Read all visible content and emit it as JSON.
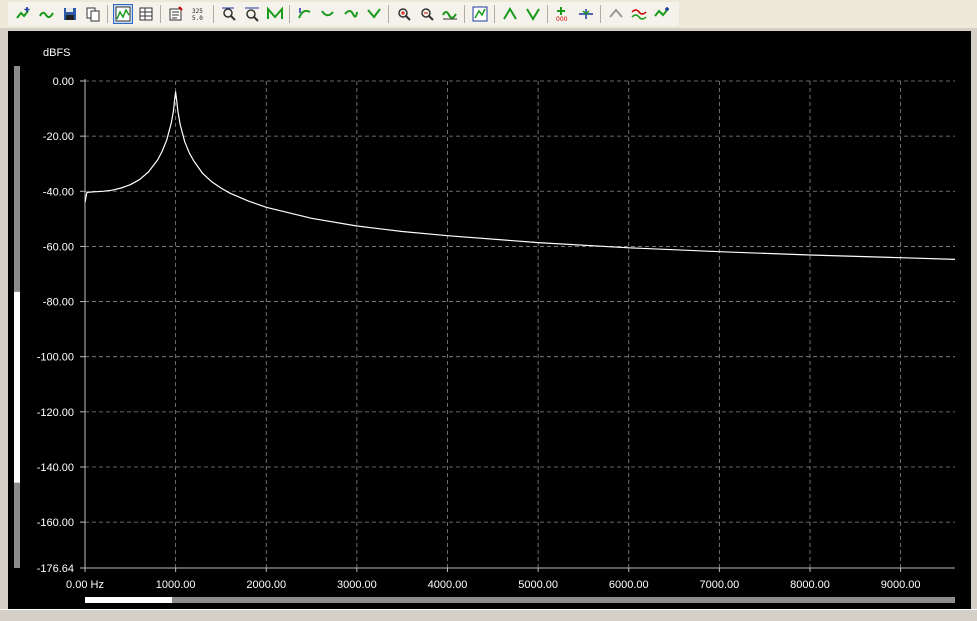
{
  "toolbar": {
    "groups": [
      [
        "add-trace-icon",
        "wave-icon",
        "save-icon",
        "copy-icon"
      ],
      [
        "spectrum-view-icon",
        "data-table-icon"
      ],
      [
        "properties-icon",
        "numeric-grid-icon"
      ],
      [
        "zoom-x-icon",
        "zoom-fit-icon",
        "trace-view-icon"
      ],
      [
        "curve-up-icon",
        "curve-down-icon",
        "curve-right-icon",
        "curve-left-icon"
      ],
      [
        "zoom-in-icon",
        "zoom-out-icon",
        "waveform-icon"
      ],
      [
        "autoscale-icon"
      ],
      [
        "peak-up-icon",
        "peak-down-icon"
      ],
      [
        "marker-icon",
        "cursor-icon"
      ],
      [
        "up-arrow-icon",
        "overlay-icon",
        "settings-icon"
      ]
    ],
    "active": [
      "spectrum-view-icon"
    ]
  },
  "chart_data": {
    "type": "line",
    "title": "",
    "ylabel": "dBFS",
    "xlabel": "",
    "xlim": [
      0,
      9600
    ],
    "ylim": [
      -176.64,
      0
    ],
    "grid": true,
    "y_ticks": [
      0,
      -20,
      -40,
      -60,
      -80,
      -100,
      -120,
      -140,
      -160,
      -176.64
    ],
    "y_tick_labels": [
      "0.00",
      "-20.00",
      "-40.00",
      "-60.00",
      "-80.00",
      "-100.00",
      "-120.00",
      "-140.00",
      "-160.00",
      "-176.64"
    ],
    "x_ticks": [
      0,
      1000,
      2000,
      3000,
      4000,
      5000,
      6000,
      7000,
      8000,
      9000
    ],
    "x_tick_labels": [
      "0.00 Hz",
      "1000.00",
      "2000.00",
      "3000.00",
      "4000.00",
      "5000.00",
      "6000.00",
      "7000.00",
      "8000.00",
      "9000.00"
    ],
    "series": [
      {
        "color": "#ffffff",
        "x": [
          0,
          20,
          50,
          100,
          200,
          300,
          400,
          500,
          600,
          700,
          800,
          850,
          900,
          950,
          975,
          990,
          1000,
          1010,
          1025,
          1050,
          1100,
          1150,
          1200,
          1300,
          1400,
          1500,
          1600,
          1800,
          2000,
          2500,
          3000,
          3500,
          4000,
          5000,
          6000,
          7000,
          8000,
          9000,
          9600
        ],
        "y": [
          -44,
          -40.5,
          -40.3,
          -40.2,
          -40,
          -39.6,
          -38.8,
          -37.6,
          -35.8,
          -33,
          -28.7,
          -25.6,
          -21.5,
          -15.5,
          -11,
          -6.5,
          -4,
          -6.5,
          -11,
          -15.8,
          -22,
          -26,
          -29,
          -33.6,
          -36.6,
          -38.8,
          -40.7,
          -43.5,
          -45.8,
          -49.8,
          -52.6,
          -54.6,
          -56.1,
          -58.6,
          -60.5,
          -61.9,
          -63.1,
          -64.1,
          -64.7
        ]
      }
    ]
  },
  "scrollbars": {
    "vertical_visible_range": [
      0.45,
      0.83
    ],
    "horizontal_visible_range": [
      0,
      0.1
    ]
  }
}
